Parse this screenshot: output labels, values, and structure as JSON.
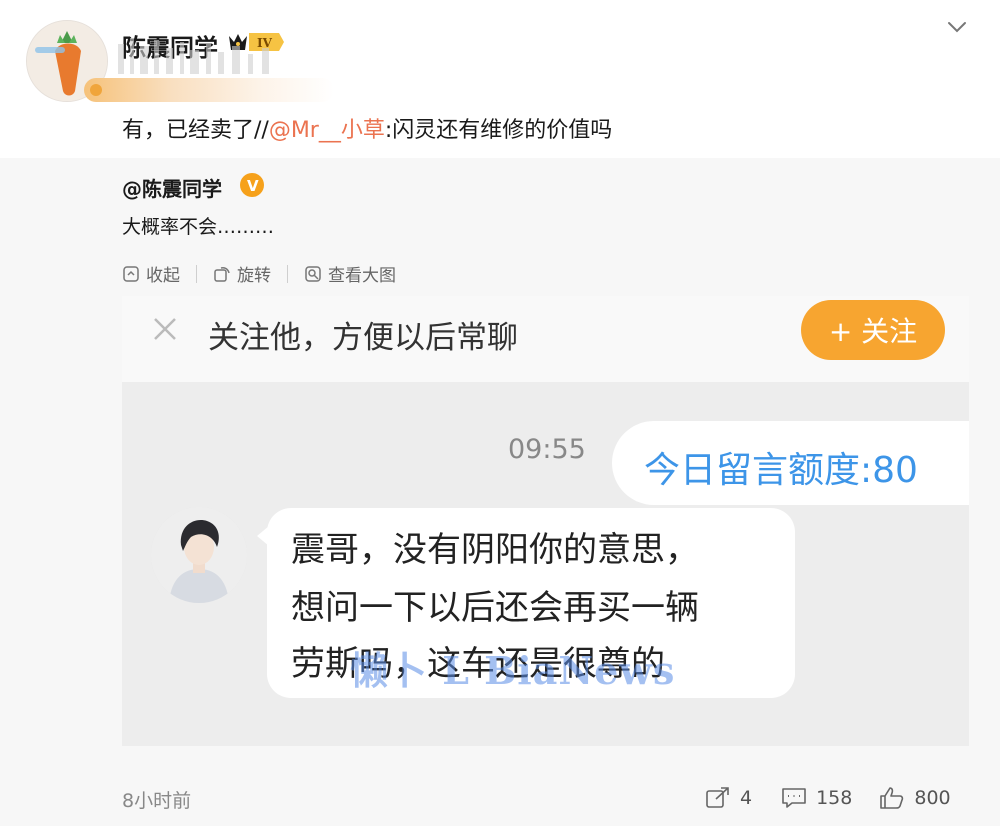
{
  "user": {
    "name": "陈震同学",
    "vip_level": "IV"
  },
  "post": {
    "text_prefix": "有，已经卖了//",
    "mention": "@Mr__小草",
    "text_suffix": ":闪灵还有维修的价值吗"
  },
  "repost": {
    "author": "@陈震同学",
    "verify_mark": "V",
    "text": "大概率不会………",
    "actions": [
      "收起",
      "旋转",
      "查看大图"
    ]
  },
  "screenshot": {
    "follow_tip": "关注他，方便以后常聊",
    "follow_button": "+ 关注",
    "time": "09:55",
    "quota": "今日留言额度:80",
    "message_lines": [
      "震哥，没有阴阳你的意思，",
      "想问一下以后还会再买一辆",
      "劳斯吗，这车还是很尊的"
    ],
    "watermark": "懒卜 L BiaNews"
  },
  "footer": {
    "time_ago": "8小时前",
    "reposts": "4",
    "comments": "158",
    "likes": "800"
  },
  "colors": {
    "mention": "#eb7350",
    "follow_button": "#f7a530",
    "quota_text": "#3d95e8",
    "repost_bg": "#f7f7f7"
  },
  "icons": [
    "chevron-down-icon",
    "collapse-icon",
    "rotate-icon",
    "view-large-icon",
    "close-icon",
    "repost-icon",
    "comment-icon",
    "like-icon"
  ]
}
